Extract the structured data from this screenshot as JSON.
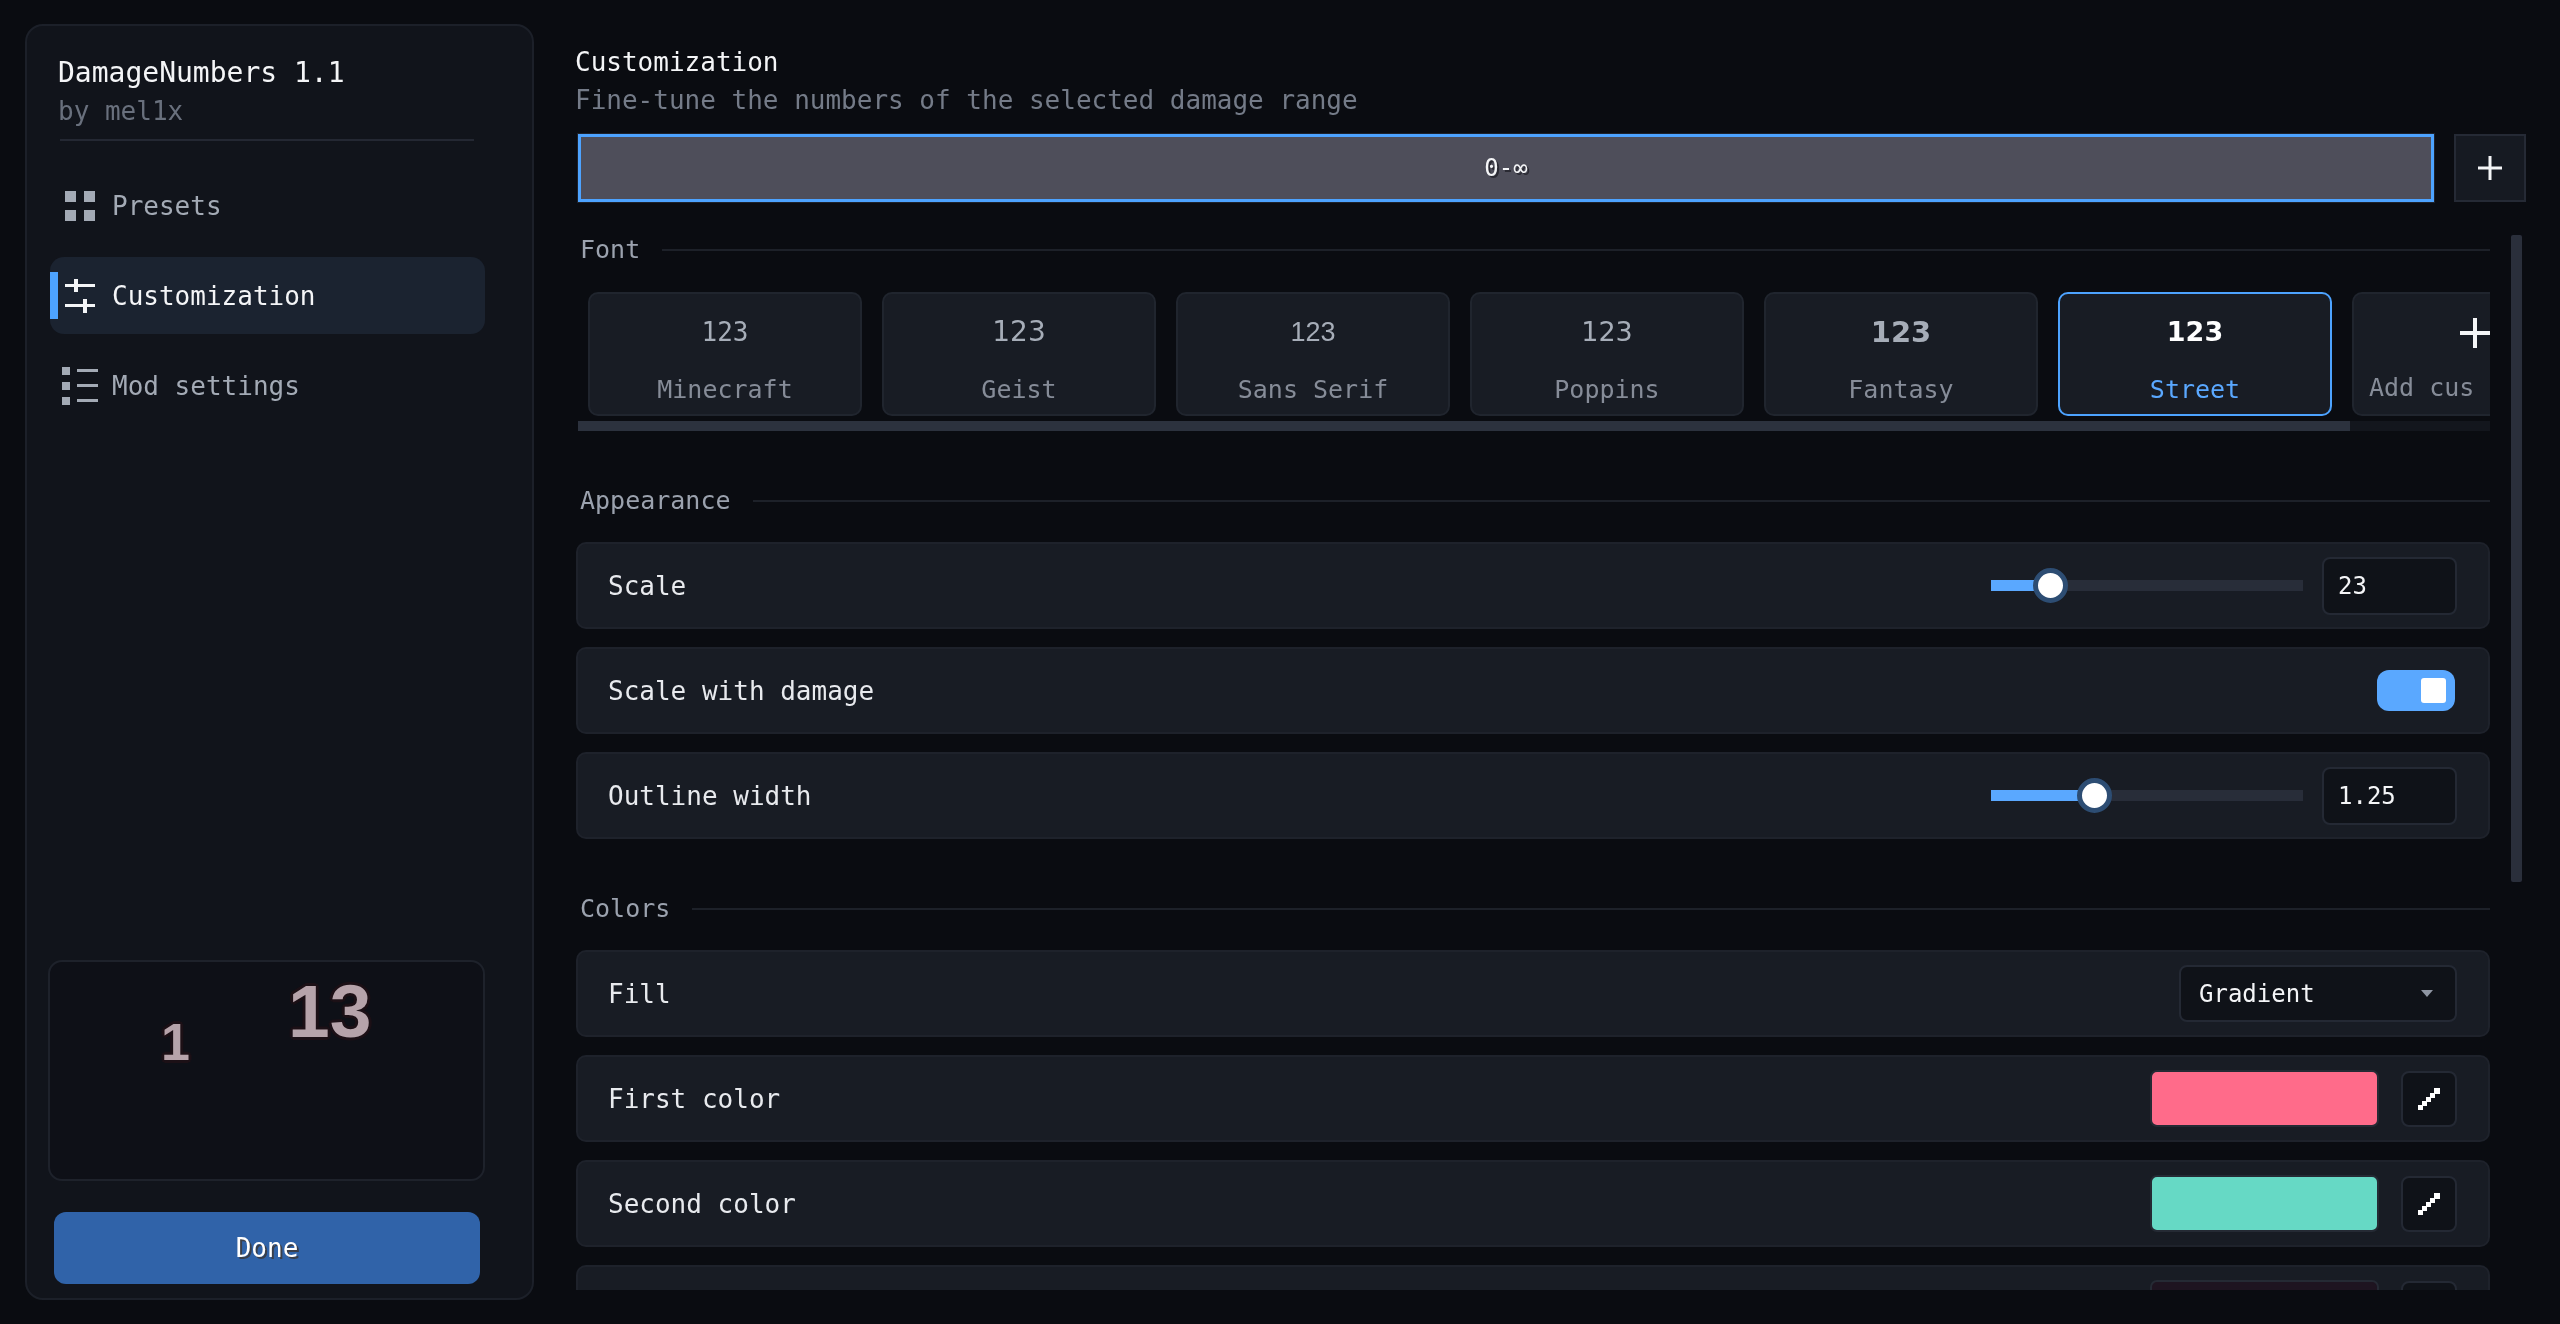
{
  "sidebar": {
    "title": "DamageNumbers 1.1",
    "author": "by mel1x",
    "nav": [
      {
        "label": "Presets",
        "selected": false
      },
      {
        "label": "Customization",
        "selected": true
      },
      {
        "label": "Mod settings",
        "selected": false
      }
    ],
    "preview": {
      "numbers": [
        "1",
        "13"
      ]
    },
    "done_button": "Done"
  },
  "main": {
    "title": "Customization",
    "subtitle": "Fine-tune the numbers of the selected damage range",
    "ranges": [
      {
        "label": "0-∞",
        "selected": true
      }
    ],
    "font": {
      "title": "Font",
      "cards": [
        {
          "kind": "font",
          "sample": "123",
          "label": "Minecraft",
          "selected": false
        },
        {
          "kind": "font",
          "sample": "123",
          "label": "Geist",
          "selected": false
        },
        {
          "kind": "font",
          "sample": "123",
          "label": "Sans Serif",
          "selected": false
        },
        {
          "kind": "font",
          "sample": "123",
          "label": "Poppins",
          "selected": false
        },
        {
          "kind": "font",
          "sample": "123",
          "label": "Fantasy",
          "selected": false
        },
        {
          "kind": "font",
          "sample": "123",
          "label": "Street",
          "selected": true
        },
        {
          "kind": "add",
          "label": "Add cus"
        }
      ]
    },
    "sections": [
      {
        "title": "Appearance",
        "rows": [
          {
            "kind": "slider",
            "label": "Scale",
            "level": 0.19,
            "value": "23"
          },
          {
            "kind": "toggle",
            "label": "Scale with damage",
            "on": true
          },
          {
            "kind": "slider",
            "label": "Outline width",
            "level": 0.33,
            "value": "1.25"
          }
        ]
      },
      {
        "title": "Colors",
        "rows": [
          {
            "kind": "dropdown",
            "label": "Fill",
            "value": "Gradient"
          },
          {
            "kind": "color",
            "label": "First color",
            "color": "#ff6b8a"
          },
          {
            "kind": "color",
            "label": "Second color",
            "color": "#66d9c5"
          },
          {
            "kind": "color",
            "color": "#1e1420"
          }
        ]
      }
    ]
  }
}
